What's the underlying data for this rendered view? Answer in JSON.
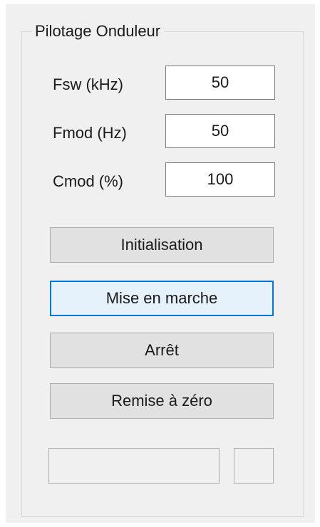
{
  "group": {
    "title": "Pilotage Onduleur"
  },
  "fields": [
    {
      "label": "Fsw (kHz)",
      "value": "50"
    },
    {
      "label": "Fmod (Hz)",
      "value": "50"
    },
    {
      "label": "Cmod (%)",
      "value": "100"
    }
  ],
  "buttons": {
    "init": "Initialisation",
    "start": "Mise en marche",
    "stop": "Arrêt",
    "reset": "Remise à zéro"
  },
  "status": {
    "text": "",
    "indicator": ""
  },
  "colors": {
    "focus_accent": "#0078d7",
    "panel_bg": "#f0f0f0",
    "button_bg": "#e1e1e1"
  }
}
